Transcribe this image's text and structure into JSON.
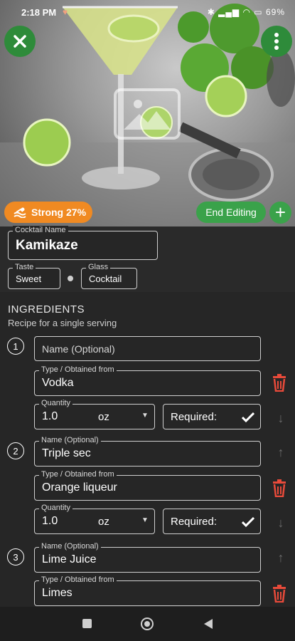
{
  "status": {
    "time": "2:18 PM",
    "battery": "69"
  },
  "hero": {
    "strength_label": "Strong 27%",
    "end_editing_label": "End Editing"
  },
  "cocktail": {
    "name_label": "Cocktail Name",
    "name_value": "Kamikaze",
    "taste_label": "Taste",
    "taste_value": "Sweet",
    "glass_label": "Glass",
    "glass_value": "Cocktail"
  },
  "ingredients": {
    "title": "INGREDIENTS",
    "subtitle": "Recipe for a single serving",
    "items": [
      {
        "number": "1",
        "name_placeholder": "Name (Optional)",
        "name_value": "",
        "type_label": "Type / Obtained from",
        "type_value": "Vodka",
        "quantity_label": "Quantity",
        "quantity_value": "1.0",
        "unit": "oz",
        "required_label": "Required:"
      },
      {
        "number": "2",
        "name_label": "Name (Optional)",
        "name_value": "Triple sec",
        "type_label": "Type / Obtained from",
        "type_value": "Orange liqueur",
        "quantity_label": "Quantity",
        "quantity_value": "1.0",
        "unit": "oz",
        "required_label": "Required:"
      },
      {
        "number": "3",
        "name_label": "Name (Optional)",
        "name_value": "Lime Juice",
        "type_label": "Type / Obtained from",
        "type_value": "Limes"
      }
    ]
  },
  "colors": {
    "accent_green": "#3aa24a",
    "strength_orange": "#f08a22",
    "delete_red": "#e84a3a"
  }
}
